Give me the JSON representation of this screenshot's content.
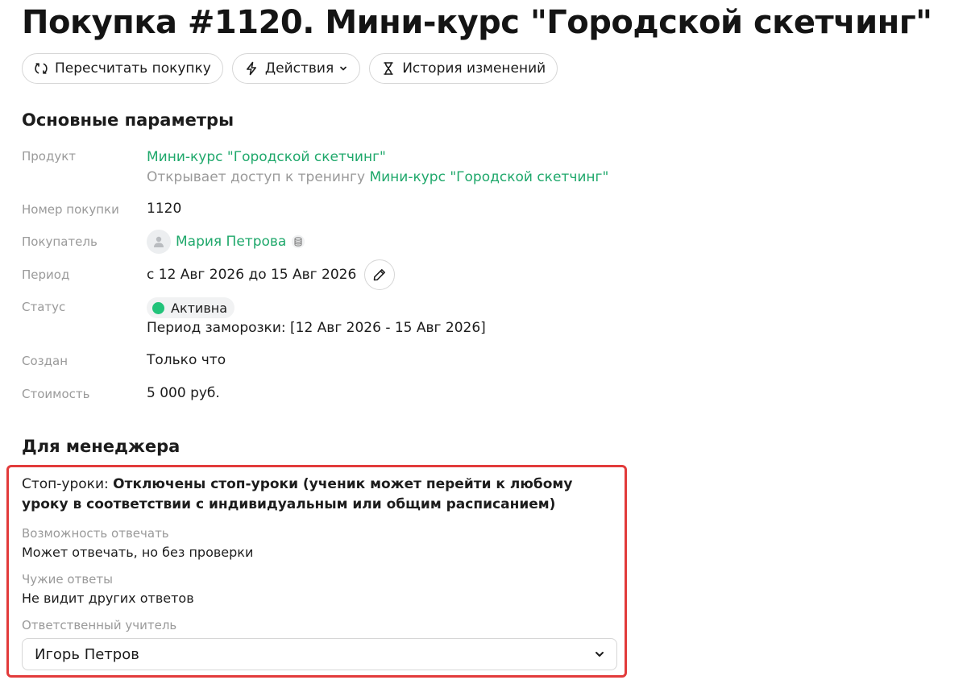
{
  "page": {
    "title": "Покупка #1120. Мини-курс \"Городской скетчинг\""
  },
  "toolbar": {
    "recalc_label": "Пересчитать покупку",
    "actions_label": "Действия",
    "history_label": "История изменений"
  },
  "main_params": {
    "section_title": "Основные параметры",
    "product": {
      "label": "Продукт",
      "value": "Мини-курс \"Городской скетчинг\"",
      "access_prefix": "Открывает доступ к тренингу",
      "access_link": "Мини-курс \"Городской скетчинг\""
    },
    "purchase_number": {
      "label": "Номер покупки",
      "value": "1120"
    },
    "buyer": {
      "label": "Покупатель",
      "value": "Мария Петрова"
    },
    "period": {
      "label": "Период",
      "value": "с 12 Авг 2026 до 15 Авг 2026"
    },
    "status": {
      "label": "Статус",
      "value": "Активна",
      "color": "#22c37a",
      "freeze_text": "Период заморозки: [12 Авг 2026 - 15 Авг 2026]"
    },
    "created": {
      "label": "Создан",
      "value": "Только что"
    },
    "cost": {
      "label": "Стоимость",
      "value": "5 000 руб."
    }
  },
  "manager": {
    "section_title": "Для менеджера",
    "stop_lessons": {
      "label": "Стоп-уроки:",
      "line1": "Отключены стоп-уроки (ученик может перейти к любому",
      "line2": "уроку в соответствии с индивидуальным или общим расписанием)"
    },
    "answer_ability": {
      "label": "Возможность отвечать",
      "value": "Может отвечать, но без проверки"
    },
    "others_answers": {
      "label": "Чужие ответы",
      "value": "Не видит других ответов"
    },
    "teacher": {
      "label": "Ответственный учитель",
      "value": "Игорь Петров"
    }
  },
  "colors": {
    "link": "#1fa86b",
    "highlight_border": "#e23b3b"
  },
  "icons": {
    "recalc": "refresh-icon",
    "actions": "lightning-icon",
    "history": "hourglass-icon",
    "avatar": "user-icon",
    "buyer_extra": "database-icon",
    "edit": "pencil-icon",
    "select": "chevron-down-icon"
  }
}
